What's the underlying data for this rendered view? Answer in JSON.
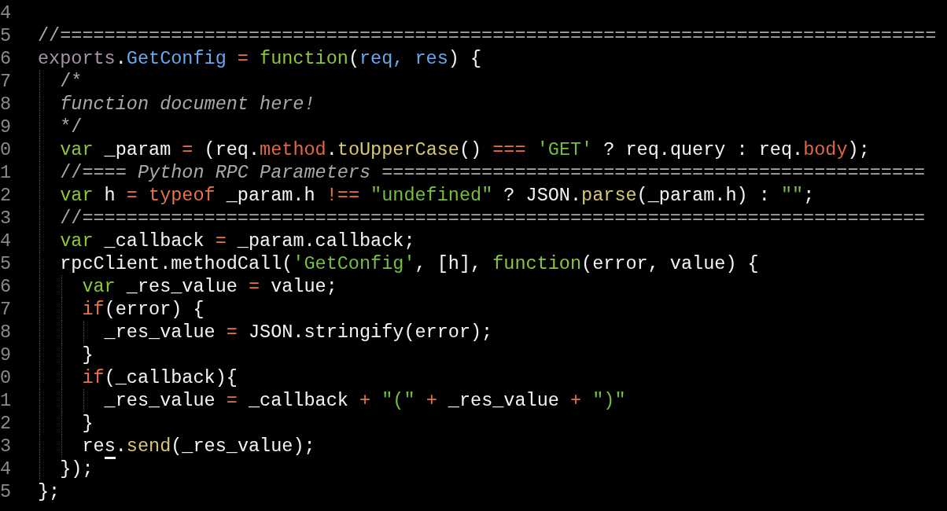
{
  "editor": {
    "lines": [
      {
        "number": "4"
      },
      {
        "number": "5",
        "tokens": [
          {
            "text": "//===============================================================================",
            "kind": "comment"
          }
        ]
      },
      {
        "number": "6",
        "tokens": [
          {
            "text": "exports",
            "kind": "object"
          },
          {
            "text": ".",
            "kind": "plain"
          },
          {
            "text": "GetConfig",
            "kind": "name"
          },
          {
            "text": " = ",
            "kind": "operator"
          },
          {
            "text": "function",
            "kind": "keyword"
          },
          {
            "text": "(",
            "kind": "plain"
          },
          {
            "text": "req, res",
            "kind": "name"
          },
          {
            "text": ") {",
            "kind": "plain"
          }
        ]
      },
      {
        "number": "7",
        "tokens": [
          {
            "text": "  /*",
            "kind": "comment"
          }
        ]
      },
      {
        "number": "8",
        "tokens": [
          {
            "text": "  function document here!",
            "kind": "doc"
          }
        ]
      },
      {
        "number": "9",
        "tokens": [
          {
            "text": "  */",
            "kind": "comment"
          }
        ]
      },
      {
        "number": "0",
        "tokens": [
          {
            "text": "  var",
            "kind": "keyword"
          },
          {
            "text": " _param ",
            "kind": "plain"
          },
          {
            "text": "=",
            "kind": "operator"
          },
          {
            "text": " (req.",
            "kind": "plain"
          },
          {
            "text": "method",
            "kind": "property"
          },
          {
            "text": ".",
            "kind": "plain"
          },
          {
            "text": "toUpperCase",
            "kind": "call"
          },
          {
            "text": "() ",
            "kind": "plain"
          },
          {
            "text": "=== ",
            "kind": "operator"
          },
          {
            "text": "'GET'",
            "kind": "string"
          },
          {
            "text": " ? req.query : req.",
            "kind": "plain"
          },
          {
            "text": "body",
            "kind": "property"
          },
          {
            "text": ");",
            "kind": "plain"
          }
        ]
      },
      {
        "number": "1",
        "tokens": [
          {
            "text": "  //==== ",
            "kind": "comment"
          },
          {
            "text": "Python RPC Parameters",
            "kind": "doc"
          },
          {
            "text": " =================================================",
            "kind": "comment"
          }
        ]
      },
      {
        "number": "2",
        "tokens": [
          {
            "text": "  var",
            "kind": "keyword"
          },
          {
            "text": " h ",
            "kind": "plain"
          },
          {
            "text": "= typeof",
            "kind": "operator"
          },
          {
            "text": " _param.h ",
            "kind": "plain"
          },
          {
            "text": "!== ",
            "kind": "operator"
          },
          {
            "text": "\"undefined\"",
            "kind": "string"
          },
          {
            "text": " ? JSON.",
            "kind": "plain"
          },
          {
            "text": "parse",
            "kind": "call"
          },
          {
            "text": "(_param.h) : ",
            "kind": "plain"
          },
          {
            "text": "\"\"",
            "kind": "string"
          },
          {
            "text": ";",
            "kind": "plain"
          }
        ]
      },
      {
        "number": "3",
        "tokens": [
          {
            "text": "  //============================================================================",
            "kind": "comment"
          }
        ]
      },
      {
        "number": "4",
        "tokens": [
          {
            "text": "  var",
            "kind": "keyword"
          },
          {
            "text": " _callback ",
            "kind": "plain"
          },
          {
            "text": "=",
            "kind": "operator"
          },
          {
            "text": " _param.callback;",
            "kind": "plain"
          }
        ]
      },
      {
        "number": "5",
        "tokens": [
          {
            "text": "  rpcClient.methodCall(",
            "kind": "plain"
          },
          {
            "text": "'GetConfig'",
            "kind": "string"
          },
          {
            "text": ", [h], ",
            "kind": "plain"
          },
          {
            "text": "function",
            "kind": "keyword"
          },
          {
            "text": "(error, value) {",
            "kind": "plain"
          }
        ]
      },
      {
        "number": "6",
        "tokens": [
          {
            "text": "    var",
            "kind": "keyword"
          },
          {
            "text": " _res_value ",
            "kind": "plain"
          },
          {
            "text": "=",
            "kind": "operator"
          },
          {
            "text": " value;",
            "kind": "plain"
          }
        ]
      },
      {
        "number": "7",
        "tokens": [
          {
            "text": "    if",
            "kind": "operator"
          },
          {
            "text": "(error) {",
            "kind": "plain"
          }
        ]
      },
      {
        "number": "8",
        "tokens": [
          {
            "text": "      _res_value ",
            "kind": "plain"
          },
          {
            "text": "=",
            "kind": "operator"
          },
          {
            "text": " JSON.stringify(error);",
            "kind": "plain"
          }
        ]
      },
      {
        "number": "9",
        "tokens": [
          {
            "text": "    }",
            "kind": "plain"
          }
        ]
      },
      {
        "number": "0",
        "tokens": [
          {
            "text": "    if",
            "kind": "operator"
          },
          {
            "text": "(_callback){",
            "kind": "plain"
          }
        ]
      },
      {
        "number": "1",
        "tokens": [
          {
            "text": "      _res_value ",
            "kind": "plain"
          },
          {
            "text": "=",
            "kind": "operator"
          },
          {
            "text": " _callback ",
            "kind": "plain"
          },
          {
            "text": "+ ",
            "kind": "operator"
          },
          {
            "text": "\"(\"",
            "kind": "string"
          },
          {
            "text": " + ",
            "kind": "operator"
          },
          {
            "text": "_res_value ",
            "kind": "plain"
          },
          {
            "text": "+ ",
            "kind": "operator"
          },
          {
            "text": "\")\"",
            "kind": "string"
          }
        ]
      },
      {
        "number": "2",
        "tokens": [
          {
            "text": "    }",
            "kind": "plain"
          }
        ]
      },
      {
        "number": "3",
        "tokens": [
          {
            "text": "    re",
            "kind": "plain"
          },
          {
            "text": "s",
            "kind": "plain",
            "cursor": true
          },
          {
            "text": ".",
            "kind": "plain"
          },
          {
            "text": "send",
            "kind": "call"
          },
          {
            "text": "(_res_value);",
            "kind": "plain"
          }
        ]
      },
      {
        "number": "4",
        "tokens": [
          {
            "text": "  });",
            "kind": "plain"
          }
        ]
      },
      {
        "number": "5",
        "tokens": [
          {
            "text": "};",
            "kind": "plain"
          }
        ]
      }
    ]
  }
}
